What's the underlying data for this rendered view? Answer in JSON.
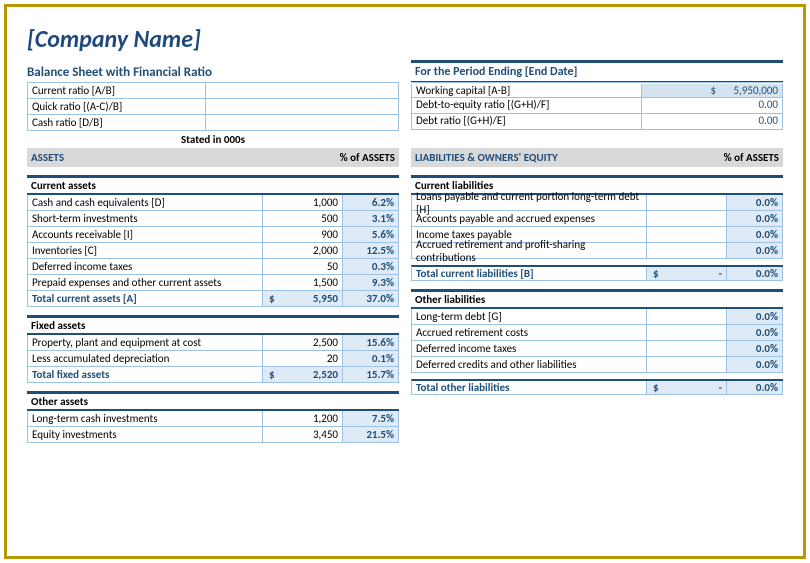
{
  "company": "[Company Name]",
  "subtitle": "Balance Sheet with Financial Ratio",
  "period": "For the Period Ending [End Date]",
  "ratios": {
    "current": "Current ratio [A/B]",
    "quick": "Quick ratio [(A-C)/B]",
    "cash": "Cash ratio [D/B]"
  },
  "working": {
    "label": "Working capital [A-B]",
    "currency": "$",
    "value": "5,950,000",
    "de_label": "Debt-to-equity ratio [(G+H)/F]",
    "de_val": "0.00",
    "dr_label": "Debt ratio [(G+H)/E]",
    "dr_val": "0.00"
  },
  "stated": "Stated in 000s",
  "assets_head": "ASSETS",
  "pct_assets": "% of ASSETS",
  "liab_head": "LIABILITIES & OWNERS' EQUITY",
  "pct_assets2": "% of ASSETS",
  "ca": {
    "head": "Current assets",
    "rows": [
      {
        "l": "Cash and cash equivalents  [D]",
        "v": "1,000",
        "p": "6.2%"
      },
      {
        "l": "Short-term investments",
        "v": "500",
        "p": "3.1%"
      },
      {
        "l": "Accounts receivable  [I]",
        "v": "900",
        "p": "5.6%"
      },
      {
        "l": "Inventories  [C]",
        "v": "2,000",
        "p": "12.5%"
      },
      {
        "l": "Deferred income taxes",
        "v": "50",
        "p": "0.3%"
      },
      {
        "l": "Prepaid expenses and other current assets",
        "v": "1,500",
        "p": "9.3%"
      }
    ],
    "tot_l": "Total current assets  [A]",
    "tot_v": "5,950",
    "tot_p": "37.0%"
  },
  "fa": {
    "head": "Fixed assets",
    "rows": [
      {
        "l": "Property, plant and equipment at cost",
        "v": "2,500",
        "p": "15.6%"
      },
      {
        "l": "Less accumulated depreciation",
        "v": "20",
        "p": "0.1%"
      }
    ],
    "tot_l": "Total fixed assets",
    "tot_v": "2,520",
    "tot_p": "15.7%"
  },
  "oa": {
    "head": "Other assets",
    "rows": [
      {
        "l": "Long-term cash investments",
        "v": "1,200",
        "p": "7.5%"
      },
      {
        "l": "Equity investments",
        "v": "3,450",
        "p": "21.5%"
      }
    ]
  },
  "cl": {
    "head": "Current liabilities",
    "rows": [
      {
        "l": "Loans payable and current portion long-term debt  [H]",
        "p": "0.0%"
      },
      {
        "l": "Accounts payable and accrued expenses",
        "p": "0.0%"
      },
      {
        "l": "Income taxes payable",
        "p": "0.0%"
      },
      {
        "l": "Accrued retirement and profit-sharing contributions",
        "p": "0.0%"
      }
    ],
    "tot_l": "Total current liabilities  [B]",
    "tot_v": "-",
    "tot_p": "0.0%"
  },
  "ol": {
    "head": "Other liabilities",
    "rows": [
      {
        "l": "Long-term debt  [G]",
        "p": "0.0%"
      },
      {
        "l": "Accrued retirement costs",
        "p": "0.0%"
      },
      {
        "l": "Deferred income taxes",
        "p": "0.0%"
      },
      {
        "l": "Deferred credits and other liabilities",
        "p": "0.0%"
      }
    ],
    "tot_l": "Total other liabilities",
    "tot_v": "-",
    "tot_p": "0.0%"
  },
  "cur": "$"
}
